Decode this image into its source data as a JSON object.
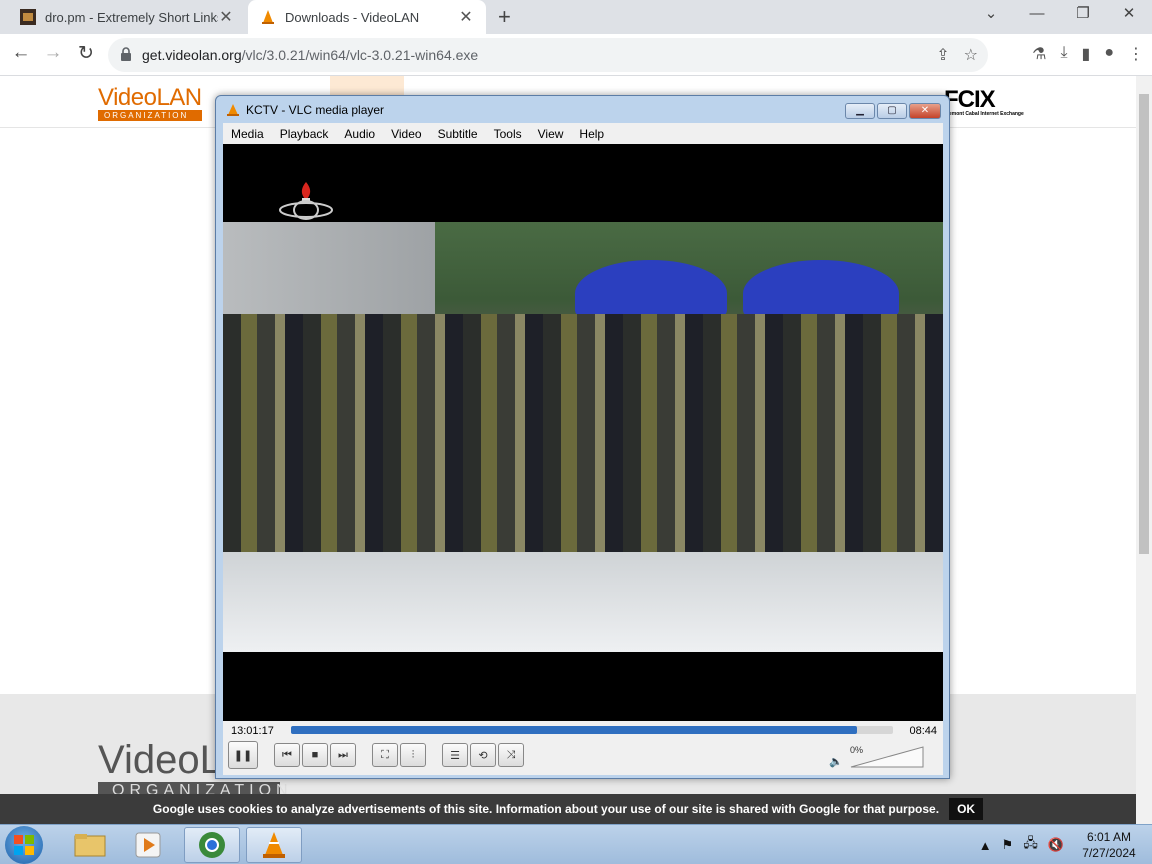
{
  "browser": {
    "tabs": [
      {
        "label": "dro.pm - Extremely Short Links"
      },
      {
        "label": "Downloads - VideoLAN"
      }
    ],
    "url_host": "get.videolan.org",
    "url_path": "/vlc/3.0.21/win64/vlc-3.0.21-win64.exe"
  },
  "page": {
    "logo_main": "VideoLAN",
    "logo_sub": "ORGANIZATION",
    "sponsor_logo": "FCIX",
    "sponsor_tag": "Fremont Cabal Internet Exchange",
    "footer_logo": "VideoLAN",
    "footer_logo_sub": "ORGANIZATION",
    "cookie_text": "Google uses cookies to analyze advertisements of this site. Information about your use of our site is shared with Google for that purpose.",
    "cookie_ok": "OK"
  },
  "vlc": {
    "title": "KCTV - VLC media player",
    "menu": [
      "Media",
      "Playback",
      "Audio",
      "Video",
      "Subtitle",
      "Tools",
      "View",
      "Help"
    ],
    "elapsed": "13:01:17",
    "remaining": "08:44",
    "seek_progress": 0.94,
    "volume_label": "0%"
  },
  "taskbar": {
    "time": "6:01 AM",
    "date": "7/27/2024"
  }
}
